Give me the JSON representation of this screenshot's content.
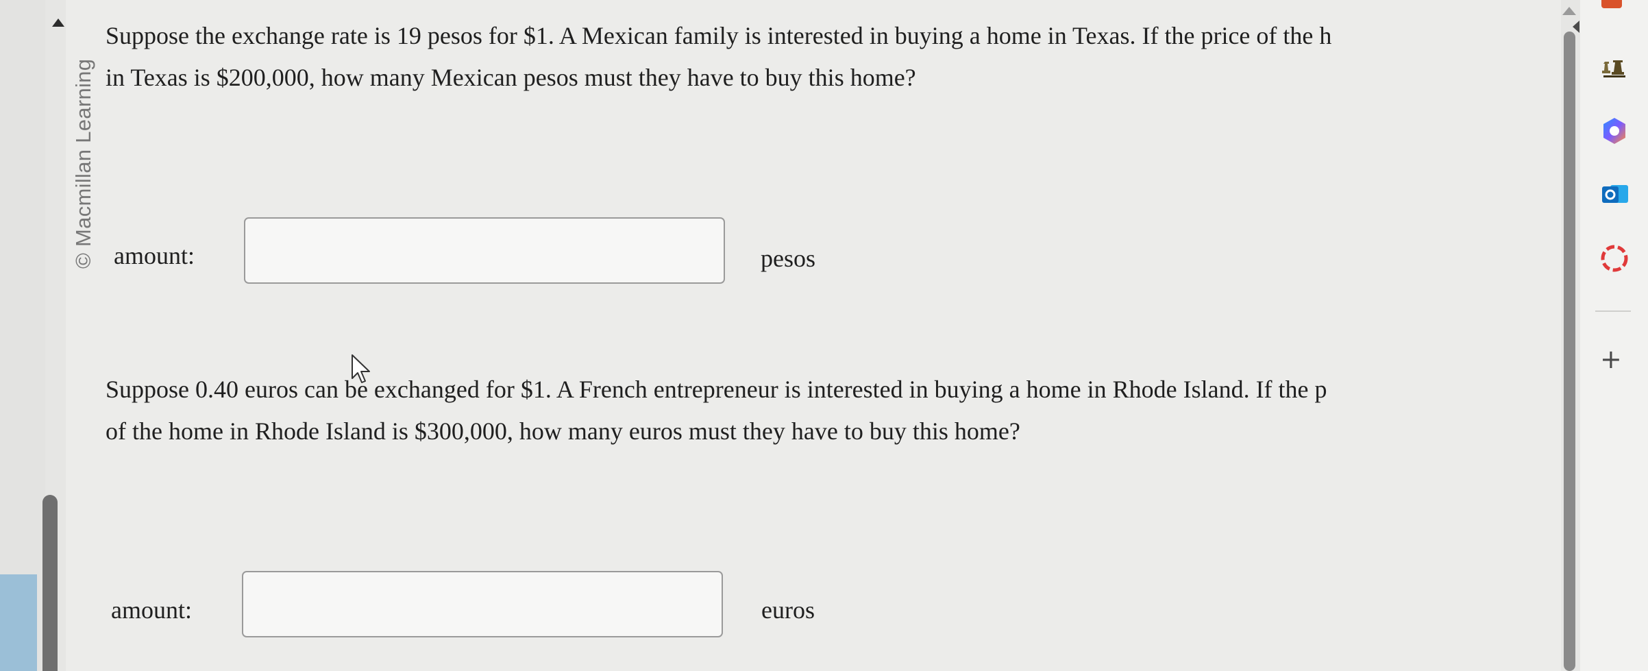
{
  "watermark": "© Macmillan Learning",
  "questions": [
    {
      "line1": "Suppose the exchange rate is 19 pesos for $1. A Mexican family is interested in buying a home in Texas. If the price of the h",
      "line2": "in Texas is $200,000, how many Mexican pesos must they have to buy this home?",
      "label": "amount:",
      "value": "",
      "unit": "pesos"
    },
    {
      "line1": "Suppose 0.40 euros can be exchanged for $1. A French entrepreneur is interested in buying a home in Rhode Island. If the p",
      "line2": "of the home in Rhode Island is $300,000, how many euros must they have to buy this home?",
      "label": "amount:",
      "value": "",
      "unit": "euros"
    }
  ],
  "sidebar": {
    "icons": [
      "chess-icon",
      "copilot-icon",
      "outlook-icon",
      "circle-icon",
      "add-icon"
    ],
    "add_label": "+"
  },
  "colors": {
    "background": "#ececea",
    "text": "#1f1f1f",
    "box_border": "#9a9a9a",
    "outlook_blue": "#0f6cbd",
    "red_accent": "#d9532b"
  }
}
